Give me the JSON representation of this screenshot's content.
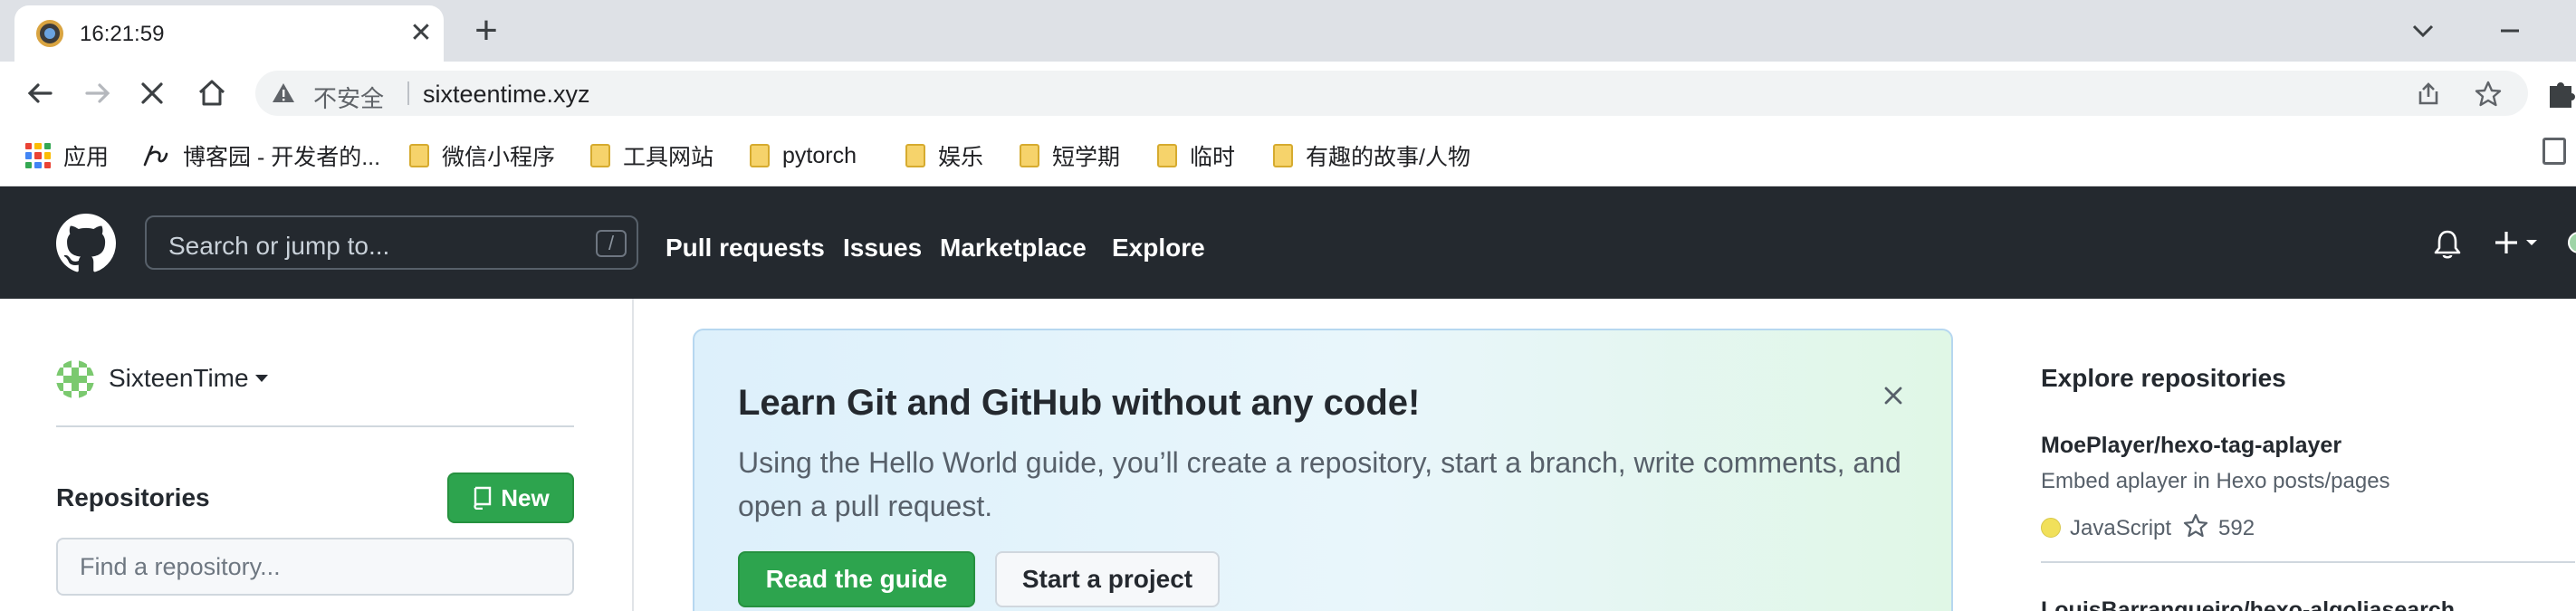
{
  "browser": {
    "tab": {
      "title": "16:21:59",
      "favicon": "site-favicon",
      "close_icon": "close-icon"
    },
    "new_tab_icon": "plus-icon",
    "toolbar": {
      "back_icon": "arrow-left-icon",
      "forward_icon": "arrow-right-icon",
      "stop_icon": "close-icon",
      "home_icon": "home-icon"
    },
    "omnibox": {
      "security_icon": "warning-icon",
      "security_label": "不安全",
      "url": "sixteentime.xyz",
      "share_icon": "share-icon",
      "bookmark_icon": "star-icon"
    },
    "bookmarks": [
      {
        "label": "应用",
        "icon": "apps-grid-icon"
      },
      {
        "label": "博客园 - 开发者的...",
        "icon": "cnblogs-icon"
      },
      {
        "label": "微信小程序",
        "icon": "folder-icon"
      },
      {
        "label": "工具网站",
        "icon": "folder-icon"
      },
      {
        "label": "pytorch",
        "icon": "folder-icon"
      },
      {
        "label": "娱乐",
        "icon": "folder-icon"
      },
      {
        "label": "短学期",
        "icon": "folder-icon"
      },
      {
        "label": "临时",
        "icon": "folder-icon"
      },
      {
        "label": "有趣的故事/人物",
        "icon": "folder-icon"
      }
    ]
  },
  "github": {
    "header": {
      "logo_icon": "github-logo-icon",
      "search_placeholder": "Search or jump to...",
      "search_shortcut": "/",
      "nav": [
        "Pull requests",
        "Issues",
        "Marketplace",
        "Explore"
      ],
      "bell_icon": "bell-icon",
      "plus_icon": "plus-icon"
    },
    "sidebar": {
      "context_user": "SixteenTime",
      "repositories_title": "Repositories",
      "new_button": "New",
      "find_placeholder": "Find a repository..."
    },
    "banner": {
      "title": "Learn Git and GitHub without any code!",
      "description": "Using the Hello World guide, you’ll create a repository, start a branch, write comments, and open a pull request.",
      "primary_button": "Read the guide",
      "secondary_button": "Start a project"
    },
    "explore": {
      "title": "Explore repositories",
      "repos": [
        {
          "name": "MoePlayer/hexo-tag-aplayer",
          "description": "Embed aplayer in Hexo posts/pages",
          "language": "JavaScript",
          "language_color": "#f1e05a",
          "stars": "592"
        },
        {
          "name": "LouisBarranqueiro/hexo-algoliasearch"
        }
      ]
    },
    "colors": {
      "header_bg": "#24292f",
      "primary_green": "#2da44e",
      "text": "#24292f",
      "muted": "#57606a"
    }
  }
}
